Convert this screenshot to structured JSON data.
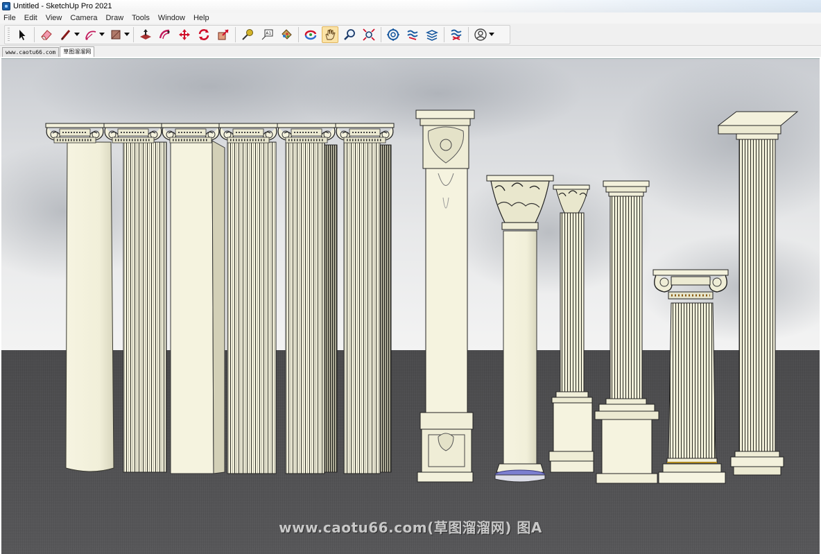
{
  "window": {
    "title": "Untitled - SketchUp Pro 2021"
  },
  "menu": [
    "File",
    "Edit",
    "View",
    "Camera",
    "Draw",
    "Tools",
    "Window",
    "Help"
  ],
  "toolbar": {
    "tools": [
      {
        "name": "select-tool-icon"
      },
      {
        "name": "eraser-tool-icon"
      },
      {
        "name": "line-tool-icon",
        "dropdown": true
      },
      {
        "name": "arc-tool-icon",
        "dropdown": true
      },
      {
        "name": "rectangle-tool-icon",
        "dropdown": true
      },
      {
        "name": "push-pull-tool-icon"
      },
      {
        "name": "offset-tool-icon"
      },
      {
        "name": "move-tool-icon"
      },
      {
        "name": "rotate-tool-icon"
      },
      {
        "name": "scale-tool-icon"
      },
      {
        "name": "tape-measure-tool-icon"
      },
      {
        "name": "text-tool-icon"
      },
      {
        "name": "paint-bucket-tool-icon"
      },
      {
        "name": "orbit-tool-icon"
      },
      {
        "name": "pan-tool-icon",
        "active": true
      },
      {
        "name": "zoom-tool-icon"
      },
      {
        "name": "zoom-extents-tool-icon"
      },
      {
        "name": "3d-warehouse-icon"
      },
      {
        "name": "extension-warehouse-icon"
      },
      {
        "name": "layout-send-icon"
      },
      {
        "name": "extension-manager-icon"
      },
      {
        "name": "account-icon",
        "dropdown": true
      }
    ]
  },
  "scenes": [
    {
      "label": "www.caotu66.com",
      "active": false
    },
    {
      "label": "草图溜溜网",
      "active": true
    }
  ],
  "watermark": "www.caotu66.com(草图溜溜网) 图A",
  "colors": {
    "column": "#f3f1dc",
    "column_shade": "#d9d6bd",
    "column_line": "#2a2a22",
    "ground": "#4f4f51",
    "sky": "#dcdde0"
  }
}
